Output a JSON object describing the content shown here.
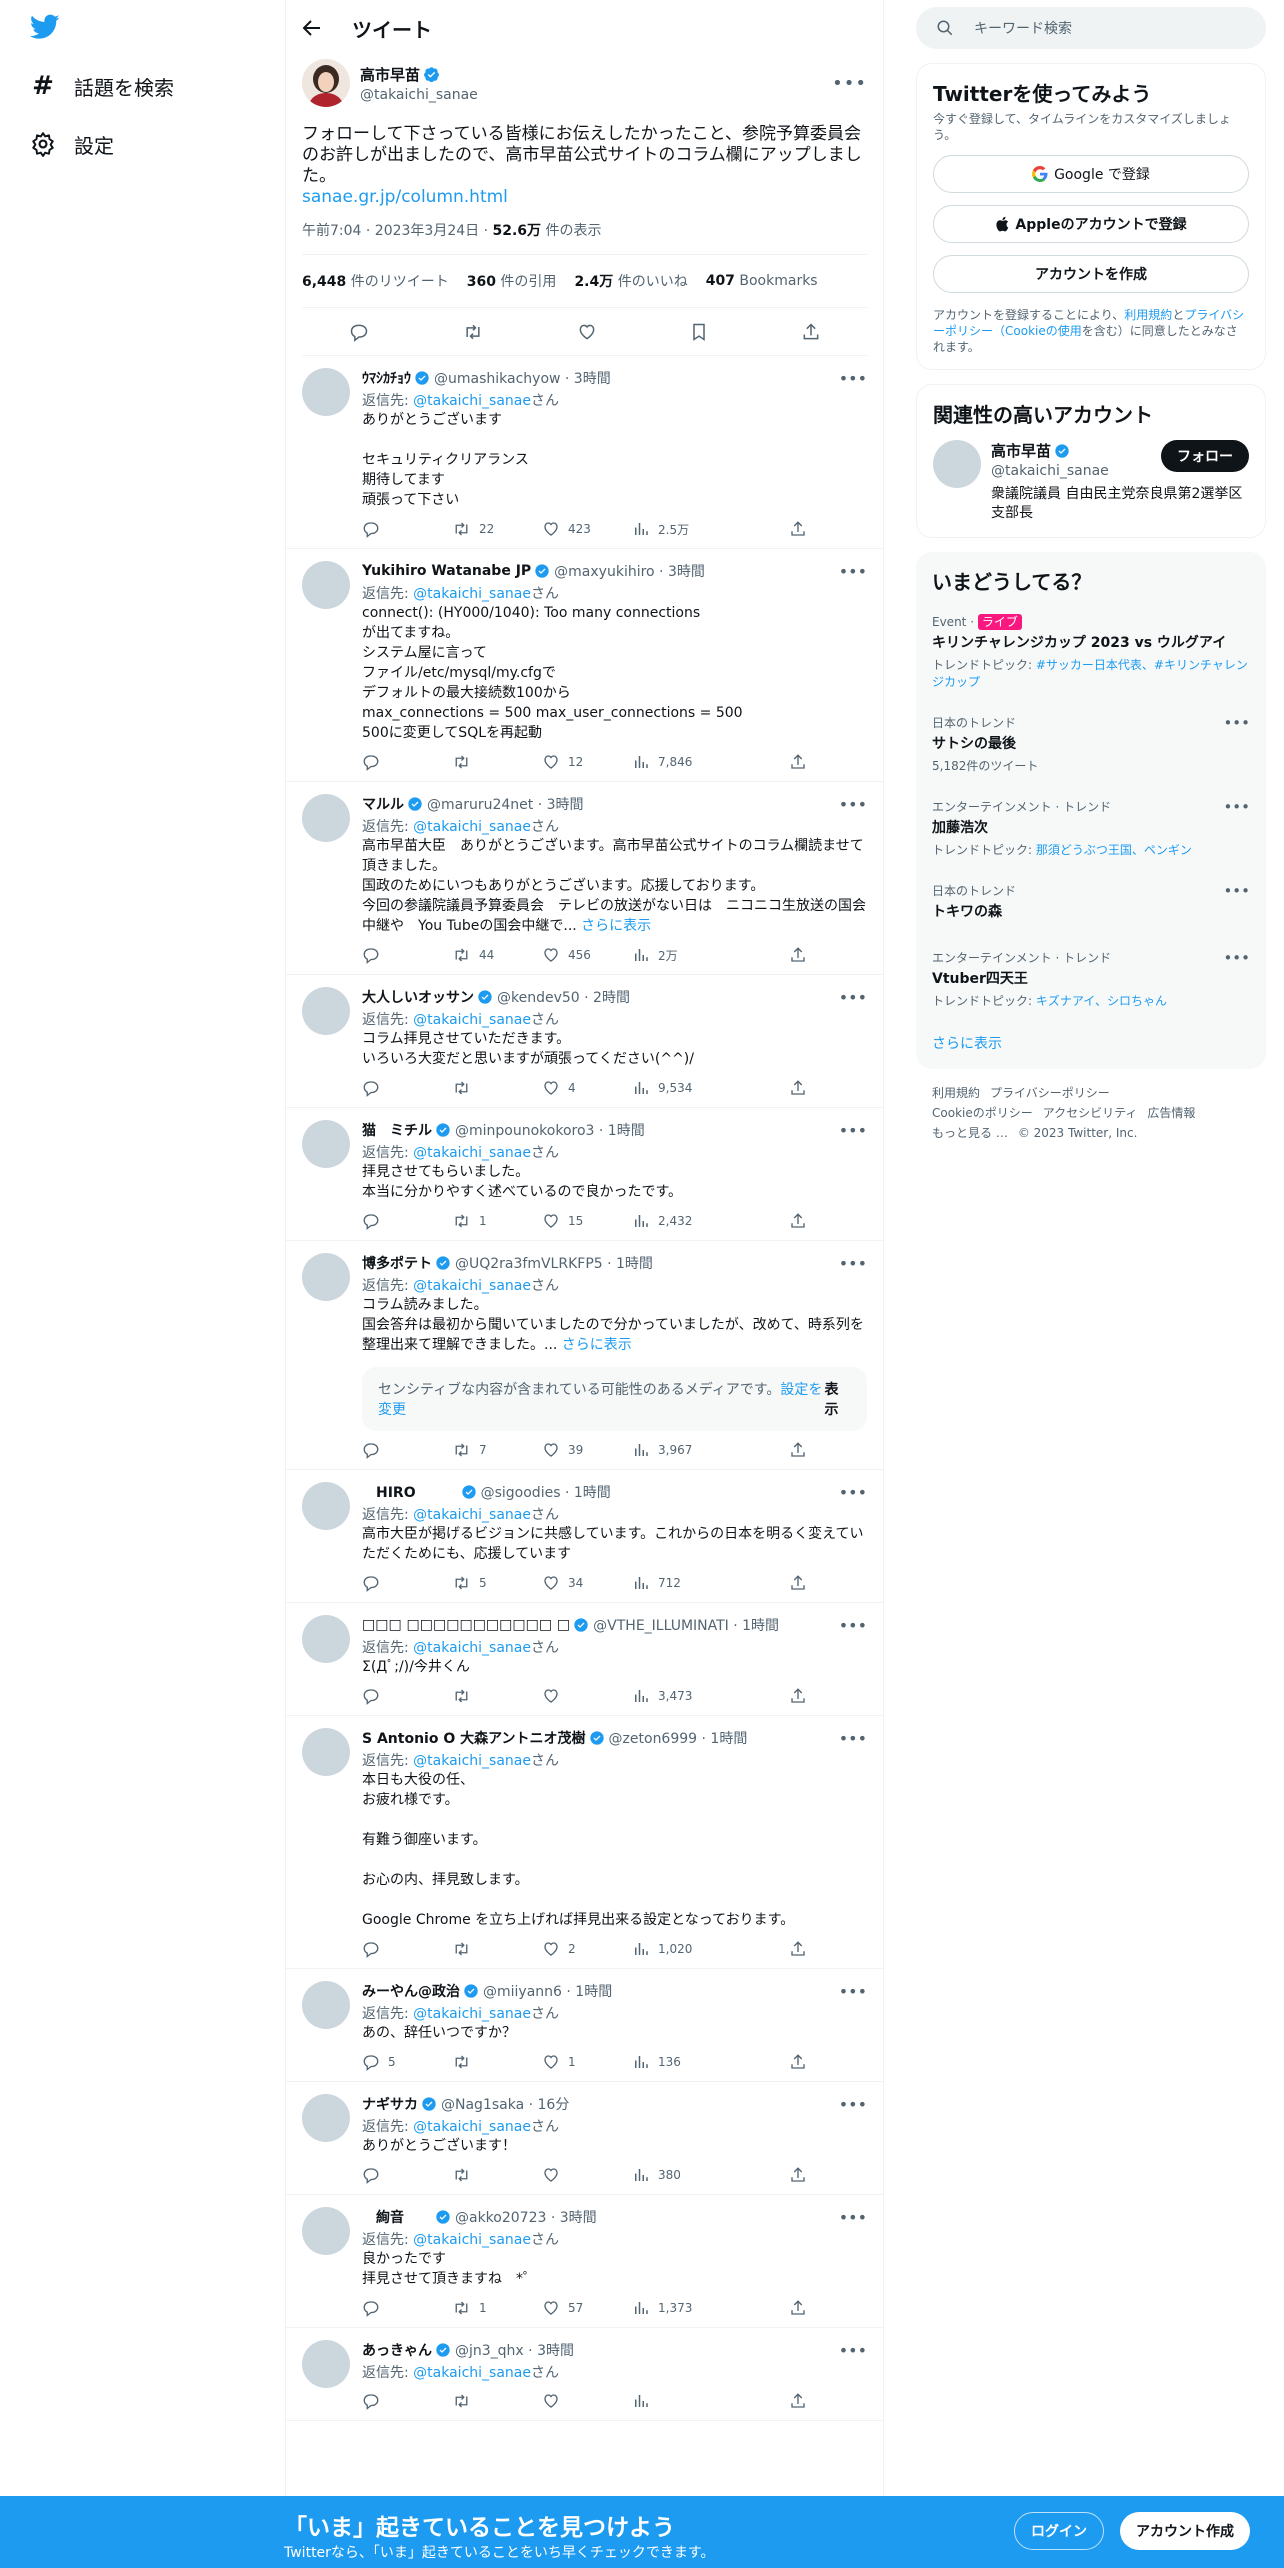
{
  "nav": {
    "explore": "話題を検索",
    "settings": "設定"
  },
  "header": {
    "title": "ツイート"
  },
  "main_tweet": {
    "name": "高市早苗",
    "handle": "@takaichi_sanae",
    "text": "フォローして下さっている皆様にお伝えしたかったこと、参院予算委員会のお許しが出ましたので、高市早苗公式サイトのコラム欄にアップしました。",
    "link": "sanae.gr.jp/column.html",
    "time": "午前7:04 · 2023年3月24日 · ",
    "views_num": "52.6万",
    "views_label": " 件の表示",
    "retweets_num": "6,448",
    "retweets_label": " 件のリツイート",
    "quotes_num": "360",
    "quotes_label": " 件の引用",
    "likes_num": "2.4万",
    "likes_label": " 件のいいね",
    "bookmarks_num": "407",
    "bookmarks_label": " Bookmarks"
  },
  "replies": [
    {
      "name": "ｳﾏｼｶﾁｮｳ",
      "handle": "@umashikachyow · 3時間",
      "reply_to": "@takaichi_sanae",
      "san": "さん",
      "text": "ありがとうございます\n\nセキュリティクリアランス\n期待してます\n頑張って下さい",
      "more": "",
      "sensitive": "",
      "reply_count": "",
      "rt": "22",
      "like": "423",
      "views": "2.5万"
    },
    {
      "name": "Yukihiro Watanabe JP",
      "handle": "@maxyukihiro · 3時間",
      "reply_to": "@takaichi_sanae",
      "san": "さん",
      "text": "connect(): (HY000/1040): Too many connections\nが出てますね。\nシステム屋に言って\nファイル/etc/mysql/my.cfgで\nデフォルトの最大接続数100から\nmax_connections = 500 max_user_connections = 500\n500に変更してSQLを再起動",
      "more": "",
      "sensitive": "",
      "reply_count": "",
      "rt": "",
      "like": "12",
      "views": "7,846"
    },
    {
      "name": "マルル",
      "handle": "@maruru24net · 3時間",
      "reply_to": "@takaichi_sanae",
      "san": "さん",
      "text": "高市早苗大臣　ありがとうございます。高市早苗公式サイトのコラム欄読ませて頂きました。\n国政のためにいつもありがとうございます。応援しております。\n今回の参議院議員予算委員会　テレビの放送がない日は　ニコニコ生放送の国会中継や　You Tubeの国会中継で...",
      "more": " さらに表示",
      "sensitive": "",
      "reply_count": "",
      "rt": "44",
      "like": "456",
      "views": "2万"
    },
    {
      "name": "大人しいオッサン",
      "handle": "@kendev50 · 2時間",
      "reply_to": "@takaichi_sanae",
      "san": "さん",
      "text": "コラム拝見させていただきます。\nいろいろ大変だと思いますが頑張ってください(^^)/",
      "more": "",
      "sensitive": "",
      "reply_count": "",
      "rt": "",
      "like": "4",
      "views": "9,534"
    },
    {
      "name": "猫　ミチル",
      "handle": "@minpounokokoro3 · 1時間",
      "reply_to": "@takaichi_sanae",
      "san": "さん",
      "text": "拝見させてもらいました。\n本当に分かりやすく述べているので良かったです。",
      "more": "",
      "sensitive": "",
      "reply_count": "",
      "rt": "1",
      "like": "15",
      "views": "2,432"
    },
    {
      "name": "博多ポテト",
      "handle": "@UQ2ra3fmVLRKFP5 · 1時間",
      "reply_to": "@takaichi_sanae",
      "san": "さん",
      "text": "コラム読みました。\n国会答弁は最初から聞いていましたので分かっていましたが、改めて、時系列を整理出来て理解できました。...",
      "more": " さらに表示",
      "sensitive": "センシティブな内容が含まれている可能性のあるメディアです。",
      "sensitive_link": "設定を変更",
      "sensitive_btn": "表示",
      "reply_count": "",
      "rt": "7",
      "like": "39",
      "views": "3,967"
    },
    {
      "name": "　HIRO　　　",
      "handle": "@sigoodies · 1時間",
      "reply_to": "@takaichi_sanae",
      "san": "さん",
      "text": "高市大臣が掲げるビジョンに共感しています。これからの日本を明るく変えていただくためにも、応援しています",
      "more": "",
      "sensitive": "",
      "reply_count": "",
      "rt": "5",
      "like": "34",
      "views": "712"
    },
    {
      "name": "□□□ □□□□□□□□□□□ □",
      "handle": "@VTHE_ILLUMINATI · 1時間",
      "reply_to": "@takaichi_sanae",
      "san": "さん",
      "text": "Σ(Дﾟ;/)/今井くん",
      "more": "",
      "sensitive": "",
      "reply_count": "",
      "rt": "",
      "like": "",
      "views": "3,473"
    },
    {
      "name": "S Antonio O 大森アントニオ茂樹",
      "handle": "@zeton6999 · 1時間",
      "reply_to": "@takaichi_sanae",
      "san": "さん",
      "text": "本日も大役の任、\nお疲れ様です。\n\n有難う御座います。\n\nお心の内、拝見致します。\n\nGoogle Chrome を立ち上げれば拝見出来る設定となっております。",
      "more": "",
      "sensitive": "",
      "reply_count": "",
      "rt": "",
      "like": "2",
      "views": "1,020"
    },
    {
      "name": "みーやん@政治",
      "handle": "@miiyann6 · 1時間",
      "reply_to": "@takaichi_sanae",
      "san": "さん",
      "text": "あの、辞任いつですか？",
      "more": "",
      "sensitive": "",
      "reply_count": "5",
      "rt": "",
      "like": "1",
      "views": "136"
    },
    {
      "name": "ナギサカ",
      "handle": "@Nag1saka · 16分",
      "reply_to": "@takaichi_sanae",
      "san": "さん",
      "text": "ありがとうございます！",
      "more": "",
      "sensitive": "",
      "reply_count": "",
      "rt": "",
      "like": "",
      "views": "380"
    },
    {
      "name": "　絢音　　",
      "handle": "@akko20723 · 3時間",
      "reply_to": "@takaichi_sanae",
      "san": "さん",
      "text": "良かったです\n 拝見させて頂きますね　*゜",
      "more": "",
      "sensitive": "",
      "reply_count": "",
      "rt": "1",
      "like": "57",
      "views": "1,373"
    },
    {
      "name": "あっきゃん",
      "handle": "@jn3_qhx · 3時間",
      "reply_to": "@takaichi_sanae",
      "san": "さん",
      "text": "",
      "more": "",
      "sensitive": "",
      "reply_count": "",
      "rt": "",
      "like": "",
      "views": ""
    }
  ],
  "search": {
    "placeholder": "キーワード検索"
  },
  "signup": {
    "title": "Twitterを使ってみよう",
    "sub": "今すぐ登録して、タイムラインをカスタマイズしましょう。",
    "google": "Google で登録",
    "apple": "Appleのアカウントで登録",
    "create": "アカウントを作成",
    "legal_pre": "アカウントを登録することにより、",
    "legal_terms": "利用規約",
    "legal_and": "と",
    "legal_privacy": "プライバシーポリシー（Cookieの使用",
    "legal_post": "を含む）に同意したとみなされます。"
  },
  "related": {
    "title": "関連性の高いアカウント",
    "name": "高市早苗",
    "handle": "@takaichi_sanae",
    "bio": "衆議院議員 自由民主党奈良県第2選挙区支部長",
    "follow": "フォロー"
  },
  "trends": {
    "title": "いまどうしてる？",
    "items": [
      {
        "ctx": "Event · ",
        "live": "ライブ",
        "name": "キリンチャレンジカップ 2023 vs ウルグアイ",
        "sub_label": "トレンドトピック: ",
        "sub_links": "#サッカー日本代表、#キリンチャレンジカップ"
      },
      {
        "ctx": "日本のトレンド",
        "live": "",
        "name": "サトシの最後",
        "sub_label": "5,182件のツイート",
        "sub_links": ""
      },
      {
        "ctx": "エンターテインメント · トレンド",
        "live": "",
        "name": "加藤浩次",
        "sub_label": "トレンドトピック: ",
        "sub_links": "那須どうぶつ王国、ペンギン"
      },
      {
        "ctx": "日本のトレンド",
        "live": "",
        "name": "トキワの森",
        "sub_label": "",
        "sub_links": ""
      },
      {
        "ctx": "エンターテインメント · トレンド",
        "live": "",
        "name": "Vtuber四天王",
        "sub_label": "トレンドトピック: ",
        "sub_links": "キズナアイ、シロちゃん"
      }
    ],
    "show_more": "さらに表示"
  },
  "footer": {
    "terms": "利用規約",
    "privacy": "プライバシーポリシー",
    "cookie": "Cookieのポリシー",
    "access": "アクセシビリティ",
    "ads": "広告情報",
    "more": "もっと見る …",
    "copy": "© 2023 Twitter, Inc."
  },
  "bottom": {
    "title": "「いま」起きていることを見つけよう",
    "sub": "Twitterなら、「いま」起きていることをいち早くチェックできます。",
    "login": "ログイン",
    "signup": "アカウント作成"
  },
  "colors": {
    "accent": "#1d9bf0",
    "live": "#f91880"
  }
}
